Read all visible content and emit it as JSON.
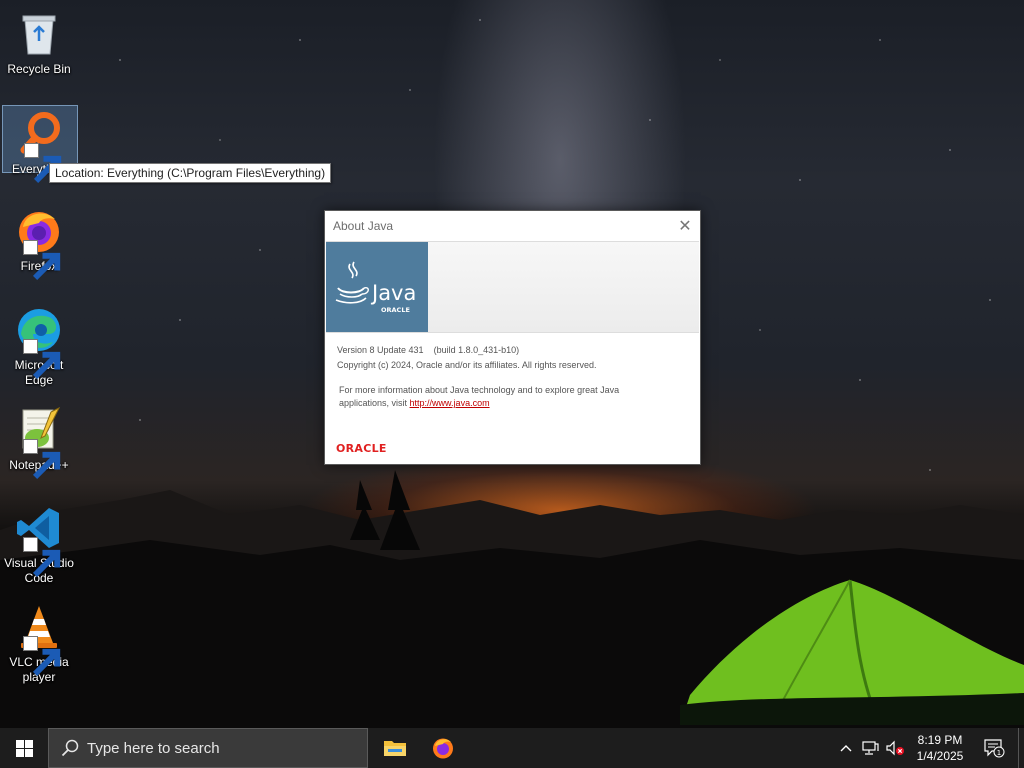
{
  "desktop": {
    "icons": [
      {
        "label": "Recycle Bin",
        "icon": "recycle-bin-icon"
      },
      {
        "label": "Everything",
        "icon": "everything-search-icon"
      },
      {
        "label": "Firefox",
        "icon": "firefox-icon"
      },
      {
        "label": "Microsoft Edge",
        "icon": "edge-icon"
      },
      {
        "label": "Notepad++",
        "icon": "notepadpp-icon"
      },
      {
        "label": "Visual Studio Code",
        "icon": "vscode-icon"
      },
      {
        "label": "VLC media player",
        "icon": "vlc-icon"
      }
    ],
    "everything_label_visible": "Everythi",
    "tooltip": "Location: Everything (C:\\Program Files\\Everything)"
  },
  "dialog": {
    "title": "About Java",
    "close_glyph": "✕",
    "logo_text": "Java",
    "logo_subtext": "ORACLE",
    "version_line": "Version 8 Update 431    (build 1.8.0_431-b10)",
    "copyright_line": "Copyright (c) 2024, Oracle and/or its affiliates. All rights reserved.",
    "info_line1": "For more information about Java technology and to explore great Java",
    "info_line2_prefix": "applications, visit ",
    "link_text": "http://www.java.com",
    "footer_logo": "ORACLE"
  },
  "taskbar": {
    "search_placeholder": "Type here to search",
    "pinned": [
      "file-explorer-icon",
      "firefox-icon"
    ],
    "tray_icons": [
      "chevron-up-icon",
      "network-icon",
      "volume-muted-icon"
    ],
    "time": "8:19 PM",
    "date": "1/4/2025",
    "notification_count": "1"
  },
  "colors": {
    "taskbar": "#1d1d1d",
    "java_blue": "#4f7c9d",
    "oracle_red": "#e02020",
    "link_red": "#c00000"
  }
}
